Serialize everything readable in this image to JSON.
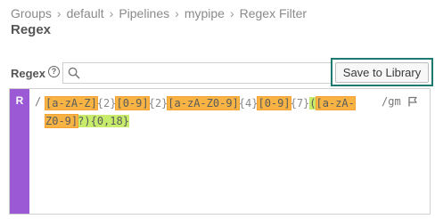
{
  "breadcrumb": {
    "items": [
      "Groups",
      "default",
      "Pipelines",
      "mypipe",
      "Regex Filter"
    ],
    "separator": "›"
  },
  "page": {
    "title": "Regex"
  },
  "regex_field": {
    "label": "Regex",
    "help_glyph": "?",
    "search_placeholder": "",
    "search_value": "",
    "save_label": "Save to Library"
  },
  "editor": {
    "badge": "R",
    "open_delim": "/",
    "flags": "/gm",
    "tokens": [
      {
        "text": "[a-zA-Z]",
        "kind": "orange"
      },
      {
        "text": "{2}",
        "kind": "quant"
      },
      {
        "text": "[0-9]",
        "kind": "orange"
      },
      {
        "text": "{2}",
        "kind": "quant"
      },
      {
        "text": "[a-zA-Z0-9]",
        "kind": "orange"
      },
      {
        "text": "{4}",
        "kind": "quant"
      },
      {
        "text": "[0-9]",
        "kind": "orange"
      },
      {
        "text": "{7}",
        "kind": "quant"
      },
      {
        "text": "(",
        "kind": "green"
      },
      {
        "text": "[a-zA-Z0-9]",
        "kind": "orange"
      },
      {
        "text": "?",
        "kind": "green"
      },
      {
        "text": ")",
        "kind": "green"
      },
      {
        "text": "{0,18}",
        "kind": "green"
      }
    ]
  },
  "colors": {
    "badge": "#9b59d6",
    "highlight_border": "#1e7a71",
    "token_orange": "#f7b445",
    "token_green": "#c7ec6c"
  }
}
